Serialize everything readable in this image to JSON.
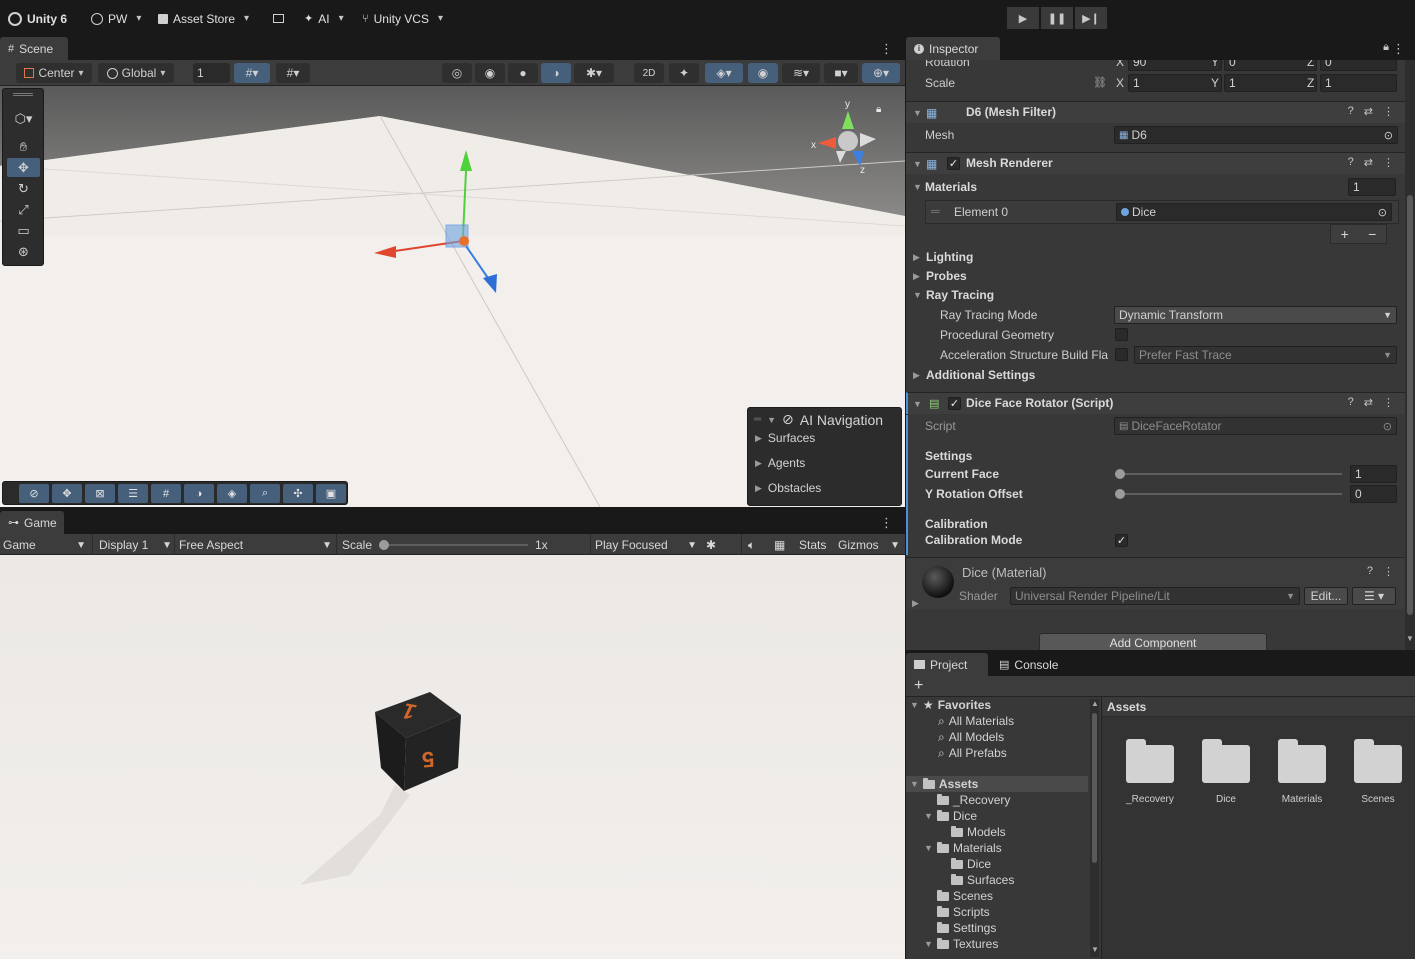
{
  "topbar": {
    "app": "Unity 6",
    "account": "PW",
    "asset_store": "Asset Store",
    "ai": "AI",
    "vcs": "Unity VCS"
  },
  "scene": {
    "tab": "Scene",
    "pivot": "Center",
    "space": "Global",
    "grid_size": "1",
    "ai_nav": {
      "title": "AI Navigation",
      "items": [
        "Surfaces",
        "Agents",
        "Obstacles"
      ]
    },
    "gizmo_axes": {
      "x": "x",
      "y": "y",
      "z": "z"
    }
  },
  "game": {
    "tab": "Game",
    "mode": "Game",
    "display": "Display 1",
    "aspect": "Free Aspect",
    "scale_label": "Scale",
    "scale_value": "1x",
    "play_mode": "Play Focused",
    "stats": "Stats",
    "gizmos": "Gizmos",
    "dice_top": "1",
    "dice_front": "5"
  },
  "inspector": {
    "tab": "Inspector",
    "rotation": {
      "label": "Rotation",
      "x": "90",
      "y": "0",
      "z": "0"
    },
    "scale": {
      "label": "Scale",
      "x": "1",
      "y": "1",
      "z": "1"
    },
    "axis": {
      "x": "X",
      "y": "Y",
      "z": "Z"
    },
    "mesh_filter": {
      "title": "D6 (Mesh Filter)",
      "mesh_label": "Mesh",
      "mesh_value": "D6"
    },
    "mesh_renderer": {
      "title": "Mesh Renderer",
      "materials_label": "Materials",
      "materials_count": "1",
      "element_label": "Element 0",
      "element_value": "Dice",
      "lighting": "Lighting",
      "probes": "Probes",
      "ray_tracing": "Ray Tracing",
      "rt_mode_label": "Ray Tracing Mode",
      "rt_mode_value": "Dynamic Transform",
      "procedural_label": "Procedural Geometry",
      "accel_label": "Acceleration Structure Build Fla",
      "accel_value": "Prefer Fast Trace",
      "additional": "Additional Settings"
    },
    "script_comp": {
      "title": "Dice Face Rotator (Script)",
      "script_label": "Script",
      "script_value": "DiceFaceRotator",
      "settings_header": "Settings",
      "current_face_label": "Current Face",
      "current_face_value": "1",
      "y_rot_label": "Y Rotation Offset",
      "y_rot_value": "0",
      "calibration_header": "Calibration",
      "calibration_mode_label": "Calibration Mode"
    },
    "material": {
      "title": "Dice (Material)",
      "shader_label": "Shader",
      "shader_value": "Universal Render Pipeline/Lit",
      "edit": "Edit..."
    },
    "add_component": "Add Component"
  },
  "project": {
    "tab_project": "Project",
    "tab_console": "Console",
    "favorites": "Favorites",
    "fav_items": [
      "All Materials",
      "All Models",
      "All Prefabs"
    ],
    "assets_root": "Assets",
    "tree": [
      {
        "label": "_Recovery",
        "depth": 1,
        "open": false
      },
      {
        "label": "Dice",
        "depth": 1,
        "open": true
      },
      {
        "label": "Models",
        "depth": 2,
        "open": false
      },
      {
        "label": "Materials",
        "depth": 1,
        "open": true
      },
      {
        "label": "Dice",
        "depth": 2,
        "open": false
      },
      {
        "label": "Surfaces",
        "depth": 2,
        "open": false
      },
      {
        "label": "Scenes",
        "depth": 1,
        "open": false
      },
      {
        "label": "Scripts",
        "depth": 1,
        "open": false
      },
      {
        "label": "Settings",
        "depth": 1,
        "open": false
      },
      {
        "label": "Textures",
        "depth": 1,
        "open": true
      }
    ],
    "assets_header": "Assets",
    "assets": [
      "_Recovery",
      "Dice",
      "Materials",
      "Scenes"
    ]
  },
  "colors": {
    "accent": "#46607c",
    "panel": "#383838",
    "bg": "#191919"
  }
}
